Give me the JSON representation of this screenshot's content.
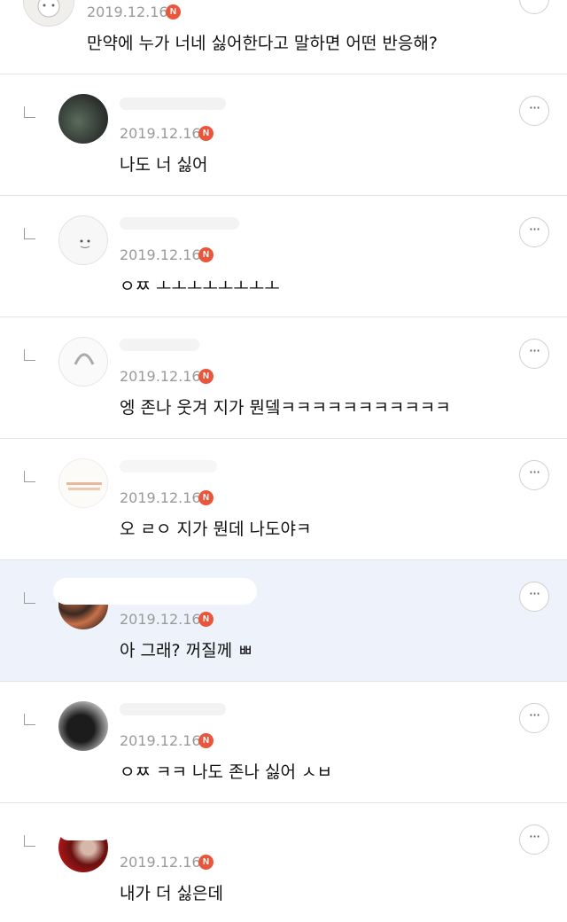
{
  "comments": [
    {
      "date": "2019.12.16",
      "badge": "N",
      "text": "만약에 누가 너네 싫어한다고 말하면 어떤 반응해?",
      "avatar": "avatar-top",
      "is_reply": false,
      "more": "···"
    },
    {
      "date": "2019.12.16",
      "badge": "N",
      "text": "나도 너 싫어",
      "avatar": "avatar-1",
      "is_reply": true,
      "more": "···"
    },
    {
      "date": "2019.12.16",
      "badge": "N",
      "text": "ㅇㅉ ㅗㅗㅗㅗㅗㅗㅗㅗ",
      "avatar": "avatar-2",
      "is_reply": true,
      "more": "···"
    },
    {
      "date": "2019.12.16",
      "badge": "N",
      "text": "엥 존나 웃겨 지가 뭔뎈ㅋㅋㅋㅋㅋㅋㅋㅋㅋㅋㅋ",
      "avatar": "avatar-3",
      "is_reply": true,
      "more": "···"
    },
    {
      "date": "2019.12.16",
      "badge": "N",
      "text": "오 ㄹㅇ 지가 뭔데 나도야ㅋ",
      "avatar": "avatar-4",
      "is_reply": true,
      "more": "···"
    },
    {
      "date": "2019.12.16",
      "badge": "N",
      "text": "아 그래? 꺼질께 ㅃ",
      "avatar": "avatar-5",
      "is_reply": true,
      "highlighted": true,
      "more": "···"
    },
    {
      "date": "2019.12.16",
      "badge": "N",
      "text": "ㅇㅉ ㅋㅋ 나도 존나 싫어 ㅅㅂ",
      "avatar": "avatar-6",
      "is_reply": true,
      "more": "···"
    },
    {
      "date": "2019.12.16",
      "badge": "N",
      "text": "내가 더 싫은데",
      "avatar": "avatar-7",
      "is_reply": true,
      "more": "···"
    }
  ],
  "colors": {
    "highlight_bg": "#eef2fb",
    "badge": "#e8573c",
    "date": "#9a9a9a",
    "divider": "#e4e4e4"
  }
}
